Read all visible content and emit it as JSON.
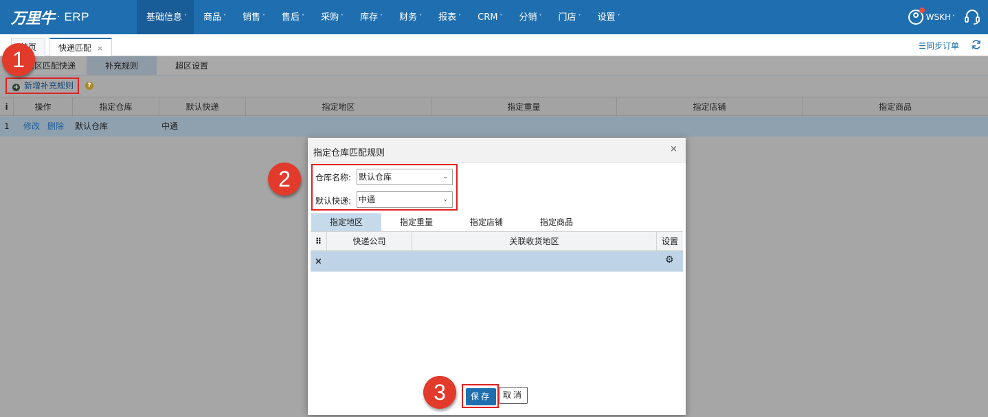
{
  "header": {
    "logo_text": "万里牛",
    "logo_dot": "·",
    "logo_suffix": "ERP",
    "menu": [
      {
        "label": "基础信息",
        "active": true
      },
      {
        "label": "商品"
      },
      {
        "label": "销售"
      },
      {
        "label": "售后"
      },
      {
        "label": "采购"
      },
      {
        "label": "库存"
      },
      {
        "label": "财务"
      },
      {
        "label": "报表"
      },
      {
        "label": "CRM"
      },
      {
        "label": "分销"
      },
      {
        "label": "门店"
      },
      {
        "label": "设置"
      }
    ],
    "caret": "˅",
    "username": "WSKH",
    "user_caret": "˅"
  },
  "page_tabs": {
    "home": "首页",
    "active": "快递匹配",
    "close": "×",
    "sync_label": "☰同步订单"
  },
  "sub_tabs": [
    "按区匹配快递",
    "补充规则",
    "超区设置"
  ],
  "toolbar": {
    "add_label": "新增补充规则",
    "add_icon": "+",
    "help_icon": "?"
  },
  "grid": {
    "columns": [
      "i",
      "操作",
      "指定仓库",
      "默认快递",
      "指定地区",
      "指定重量",
      "指定店铺",
      "指定商品"
    ],
    "rows": [
      {
        "index": "1",
        "edit": "修改",
        "delete": "删除",
        "warehouse": "默认仓库",
        "express": "中通",
        "region": "",
        "weight": "",
        "shop": "",
        "goods": ""
      }
    ]
  },
  "modal": {
    "title": "指定仓库匹配规则",
    "close": "×",
    "warehouse_label": "仓库名称:",
    "warehouse_value": "默认仓库",
    "express_label": "默认快递:",
    "express_value": "中通",
    "chevron": "⌄",
    "tabs": [
      "指定地区",
      "指定重量",
      "指定店铺",
      "指定商品"
    ],
    "active_tab": "指定地区",
    "table_columns": [
      "⠿",
      "快递公司",
      "关联收货地区",
      "设置"
    ],
    "row_delete": "×",
    "row_settings": "⚙",
    "save": "保存",
    "cancel": "取消"
  },
  "steps": [
    "1",
    "2",
    "3"
  ],
  "colors": {
    "nav": "#1f6fb0",
    "accent_red": "#e23a2b",
    "active_tab": "#c5daea"
  }
}
